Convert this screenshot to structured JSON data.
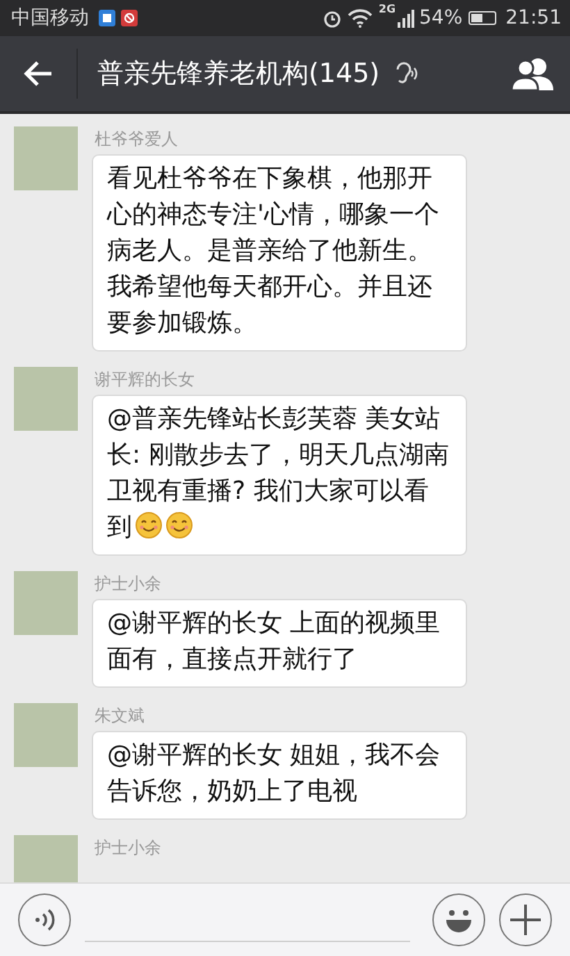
{
  "status_bar": {
    "carrier": "中国移动",
    "network": "2G",
    "battery": "54%",
    "time": "21:51"
  },
  "header": {
    "title": "普亲先锋养老机构(145)"
  },
  "messages": [
    {
      "sender": "杜爷爷爱人",
      "parts": [
        {
          "kind": "text",
          "text": "看见杜爷爷在下象棋，他那开心的神态专注'心情，哪象一个病老人。是普亲给了他新生。我希望他每天都开心。并且还要参加锻炼。"
        }
      ]
    },
    {
      "sender": "谢平辉的长女",
      "parts": [
        {
          "kind": "text",
          "text": "@普亲先锋站长彭芙蓉 美女站长: 刚散步去了，明天几点湖南卫视有重播? 我们大家可以看到"
        },
        {
          "kind": "emoji"
        },
        {
          "kind": "emoji"
        }
      ]
    },
    {
      "sender": "护士小余",
      "parts": [
        {
          "kind": "text",
          "text": "@谢平辉的长女 上面的视频里面有，直接点开就行了"
        }
      ]
    },
    {
      "sender": "朱文斌",
      "parts": [
        {
          "kind": "text",
          "text": "@谢平辉的长女 姐姐，我不会告诉您，奶奶上了电视"
        }
      ]
    },
    {
      "sender": "护士小余"
    }
  ]
}
